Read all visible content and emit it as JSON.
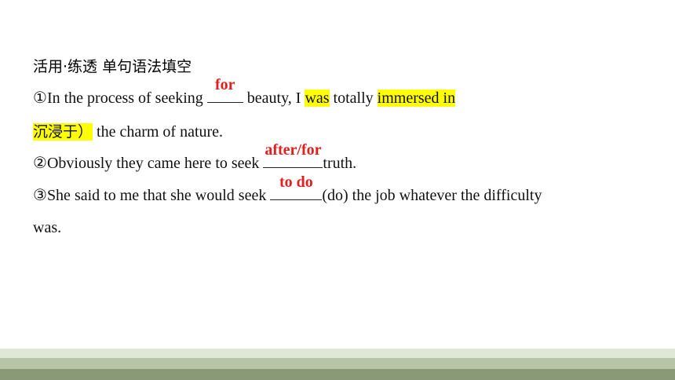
{
  "title": "活用·练透 单句语法填空",
  "q1": {
    "num": "①",
    "text_a": "In the process of seeking ",
    "answer": "for",
    "text_b": " beauty, I ",
    "hl_was": "was",
    "text_c": " totally ",
    "hl_immersed": "immersed in",
    "cn_hl": "沉浸于）",
    "text_d": " the charm of nature."
  },
  "q2": {
    "num": "②",
    "text_a": "Obviously they came here to seek ",
    "answer": "after/for",
    "text_b": "truth."
  },
  "q3": {
    "num": "③",
    "text_a": "She said to me that she would seek ",
    "answer": "to do",
    "text_b": "(do) the job whatever the difficulty",
    "text_c": "was."
  },
  "colors": {
    "answer": "#e02020",
    "highlight": "#ffff00"
  }
}
